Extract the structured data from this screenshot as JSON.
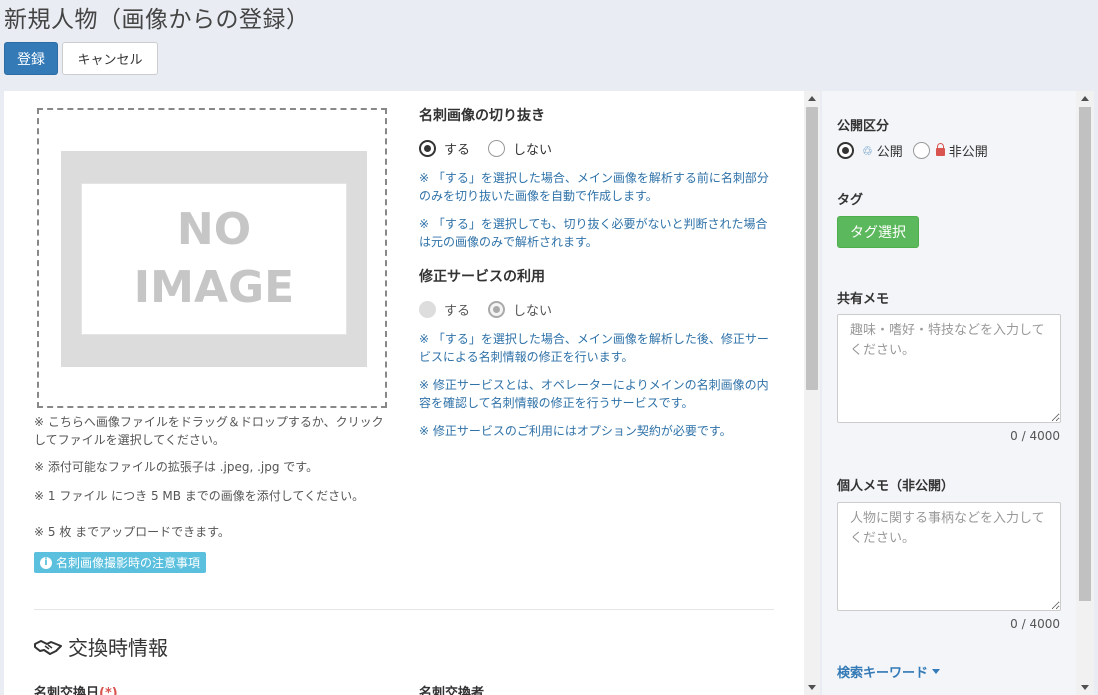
{
  "page_title": "新規人物（画像からの登録）",
  "toolbar": {
    "register_label": "登録",
    "cancel_label": "キャンセル"
  },
  "upload": {
    "no_image_line1": "NO",
    "no_image_line2": "IMAGE",
    "notes": [
      "※ こちらへ画像ファイルをドラッグ＆ドロップするか、クリックしてファイルを選択してください。",
      "※ 添付可能なファイルの拡張子は .jpeg, .jpg です。",
      "※ 1 ファイル につき 5 MB までの画像を添付してください。",
      "※ 5 枚 までアップロードできます。"
    ],
    "tips_badge": "名刺画像撮影時の注意事項"
  },
  "crop": {
    "heading": "名刺画像の切り抜き",
    "option_yes": "する",
    "option_no": "しない",
    "selected": "する",
    "notes": [
      "※ 「する」を選択した場合、メイン画像を解析する前に名刺部分のみを切り抜いた画像を自動で作成します。",
      "※ 「する」を選択しても、切り抜く必要がないと判断された場合は元の画像のみで解析されます。"
    ]
  },
  "correction": {
    "heading": "修正サービスの利用",
    "option_yes": "する",
    "option_no": "しない",
    "selected": "しない",
    "notes": [
      "※ 「する」を選択した場合、メイン画像を解析した後、修正サービスによる名刺情報の修正を行います。",
      "※ 修正サービスとは、オペレーターによりメインの名刺画像の内容を確認して名刺情報の修正を行うサービスです。",
      "※ 修正サービスのご利用にはオプション契約が必要です。"
    ]
  },
  "exchange": {
    "title": "交換時情報",
    "date_label": "名刺交換日",
    "required_mark": "(*)",
    "person_label": "名刺交換者"
  },
  "sidebar": {
    "visibility_label": "公開区分",
    "visibility_public": "公開",
    "visibility_private": "非公開",
    "visibility_selected": "公開",
    "tag_label": "タグ",
    "tag_button": "タグ選択",
    "shared_memo_label": "共有メモ",
    "shared_memo_placeholder": "趣味・嗜好・特技などを入力してください。",
    "shared_memo_counter": "0 / 4000",
    "private_memo_label": "個人メモ（非公開）",
    "private_memo_placeholder": "人物に関する事柄などを入力してください。",
    "private_memo_counter": "0 / 4000",
    "keyword_link": "検索キーワード"
  },
  "colors": {
    "primary": "#337ab7",
    "success": "#5cb85c",
    "info": "#5bc0de",
    "note_blue": "#2f72a8",
    "required": "#d9534f"
  },
  "icons": [
    "info-icon",
    "handshake-icon",
    "public-icon",
    "lock-icon",
    "caret-down-icon"
  ]
}
